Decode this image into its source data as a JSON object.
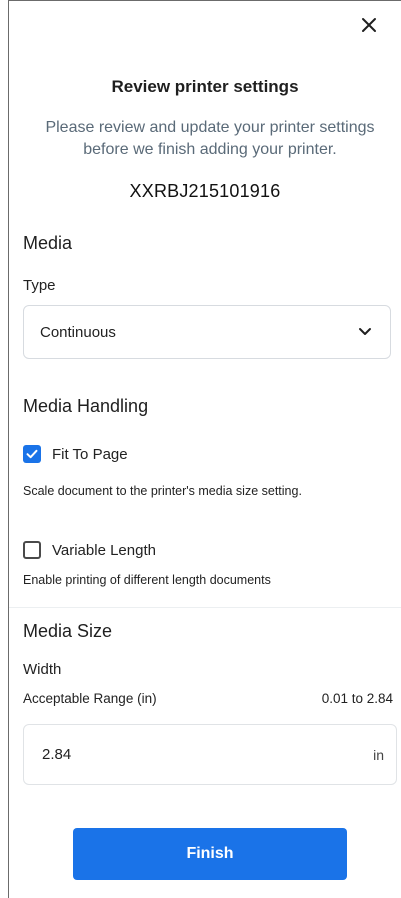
{
  "dialog": {
    "title": "Review printer settings",
    "subtitle": "Please review and update your printer settings before we finish adding your printer.",
    "serial": "XXRBJ215101916",
    "close_icon": "close-icon"
  },
  "media": {
    "heading": "Media",
    "type_label": "Type",
    "type_value": "Continuous"
  },
  "media_handling": {
    "heading": "Media Handling",
    "fit_to_page": {
      "label": "Fit To Page",
      "checked": true,
      "helper": "Scale document to the printer's media size setting."
    },
    "variable_length": {
      "label": "Variable Length",
      "checked": false,
      "helper": "Enable printing of different length documents"
    }
  },
  "media_size": {
    "heading": "Media Size",
    "width_label": "Width",
    "range_label": "Acceptable Range (in)",
    "range_value": "0.01 to 2.84",
    "width_value": "2.84",
    "unit": "in"
  },
  "actions": {
    "finish_label": "Finish"
  },
  "colors": {
    "accent": "#1a73e8",
    "subtitle_text": "#5a6a78"
  }
}
